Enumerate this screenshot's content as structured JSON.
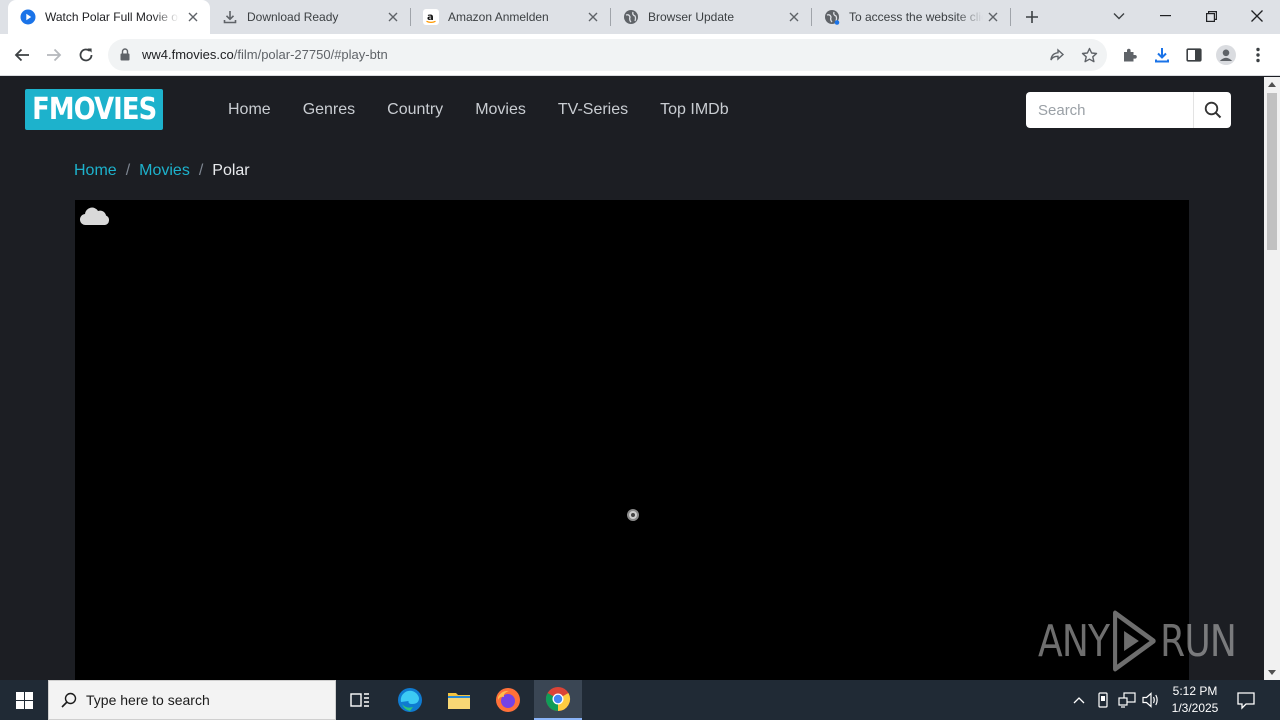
{
  "browser": {
    "tabs": [
      {
        "title": "Watch Polar Full Movie online Free",
        "favicon": "play-circle-icon",
        "active": true
      },
      {
        "title": "Download Ready",
        "favicon": "download-icon",
        "active": false
      },
      {
        "title": "Amazon Anmelden",
        "favicon": "amazon-icon",
        "active": false
      },
      {
        "title": "Browser Update",
        "favicon": "globe-icon",
        "active": false
      },
      {
        "title": "To access the website click",
        "favicon": "globe-icon",
        "active": false
      }
    ],
    "url_host": "ww4.fmovies.co",
    "url_path": "/film/polar-27750/#play-btn"
  },
  "site": {
    "logo_text": "FMOVIES",
    "brand_color": "#1db2cc",
    "nav": [
      "Home",
      "Genres",
      "Country",
      "Movies",
      "TV-Series",
      "Top IMDb"
    ],
    "search_placeholder": "Search",
    "breadcrumb": {
      "home": "Home",
      "movies": "Movies",
      "current": "Polar"
    }
  },
  "watermark": {
    "text_left": "ANY",
    "text_right": "RUN"
  },
  "taskbar": {
    "search_placeholder": "Type here to search",
    "time": "5:12 PM",
    "date": "1/3/2025"
  }
}
